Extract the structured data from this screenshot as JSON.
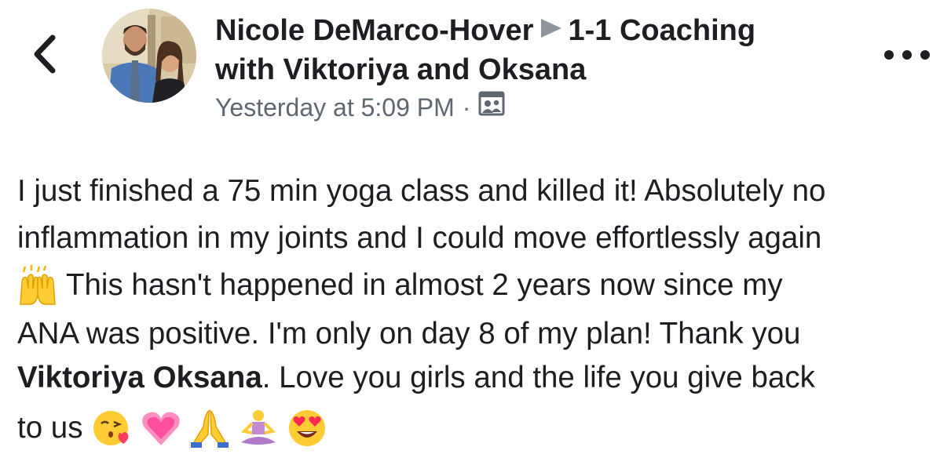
{
  "header": {
    "author": "Nicole DeMarco-Hover",
    "group_title_part1": "1-1 Coaching",
    "group_title_part2": "with Viktoriya and Oksana",
    "timestamp": "Yesterday at 5:09 PM",
    "separator": "·",
    "audience_icon": "closed-group-icon",
    "back_icon": "chevron-left-icon",
    "more_icon": "more-horizontal-icon"
  },
  "post": {
    "line1": "I just finished a 75 min yoga class and killed it! Absolutely no",
    "line2": "inflammation in my joints and I could move effortlessly again",
    "line3_text": "This hasn't happened in almost 2 years now since my",
    "line4": "ANA was positive. I'm only on day 8 of my plan! Thank you",
    "mention": "Viktoriya Oksana",
    "line5_rest": ". Love you girls and the life you give back",
    "line6_text": "to us",
    "emojis": {
      "line3": [
        "raised-hands-emoji"
      ],
      "line6": [
        "face-blowing-kiss-emoji",
        "growing-heart-emoji",
        "folded-hands-emoji",
        "person-in-lotus-position-emoji",
        "heart-eyes-emoji"
      ]
    }
  },
  "colors": {
    "text": "#1c1e21",
    "secondary_text": "#606770",
    "arrow": "#90949c",
    "emoji_yellow": "#ffcc33",
    "heart_pink": "#ff5fa2"
  }
}
